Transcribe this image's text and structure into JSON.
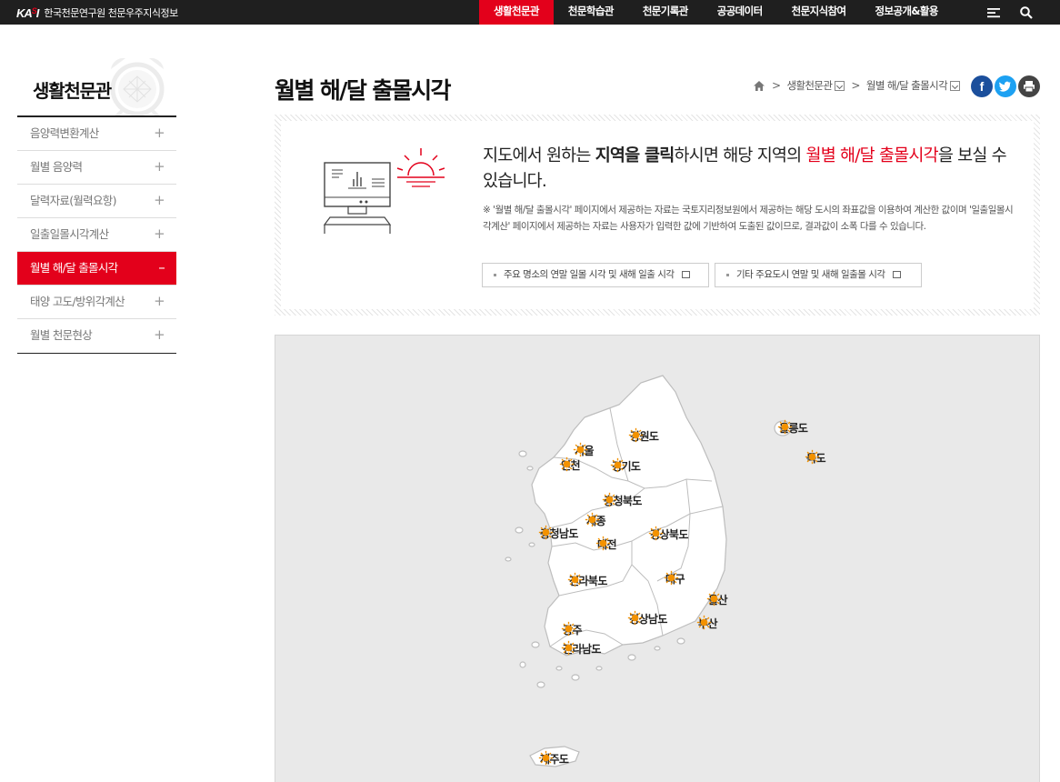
{
  "header": {
    "logo_mark": "KA",
    "logo_mark_sep": "S",
    "logo_mark_end": "I",
    "logo_text": "한국천문연구원 천문우주지식정보",
    "nav": [
      "생활천문관",
      "천문학습관",
      "천문기록관",
      "공공데이터",
      "천문지식참여",
      "정보공개&활용"
    ],
    "icons": [
      "menu-icon",
      "search-icon"
    ]
  },
  "sidebar": {
    "title": "생활천문관",
    "items": [
      {
        "label": "음양력변환계산",
        "active": false
      },
      {
        "label": "월별 음양력",
        "active": false
      },
      {
        "label": "달력자료(월력요항)",
        "active": false
      },
      {
        "label": "일출일몰시각계산",
        "active": false
      },
      {
        "label": "월별 해/달 출몰시각",
        "active": true
      },
      {
        "label": "태양 고도/방위각계산",
        "active": false
      },
      {
        "label": "월별 천문현상",
        "active": false
      }
    ],
    "plus": "+",
    "minus": "–"
  },
  "page": {
    "title": "월별 해/달 출몰시각",
    "breadcrumb": [
      "생활천문관",
      "월별 해/달 출몰시각"
    ],
    "sep": ">"
  },
  "info": {
    "head_1": "지도에서 원하는 ",
    "head_bold": "지역을 클릭",
    "head_2": "하시면 해당 지역의 ",
    "head_red": "월별 해/달 출몰시각",
    "head_3": "을 보실 수 있습니다.",
    "note": "※ '월별 해/달 출몰시각' 페이지에서 제공하는 자료는 국토지리정보원에서 제공하는 해당 도시의 좌표값을 이용하여 계산한 값이며 '일출일몰시각계산' 페이지에서 제공하는 자료는 사용자가 입력한 값에 기반하여 도출된 값이므로, 결과값이 소폭 다를 수 있습니다.",
    "btn_1": "주요 명소의 연말 일몰 시각 및 새해 일출 시각",
    "btn_2": "기타 주요도시 연말 및 새해 일출몰 시각"
  },
  "map": {
    "cities": [
      "강원도",
      "서울",
      "인천",
      "경기도",
      "충청북도",
      "세종",
      "충청남도",
      "대전",
      "경상북도",
      "전라북도",
      "대구",
      "울산",
      "경상남도",
      "부산",
      "광주",
      "전라남도",
      "제주도",
      "울릉도",
      "독도"
    ]
  },
  "colors": {
    "accent": "#e3001b",
    "sun": "#f39200",
    "topbar": "#1f1f1f",
    "facebook": "#1b4f9c",
    "twitter": "#1da1f2",
    "print": "#444444"
  }
}
